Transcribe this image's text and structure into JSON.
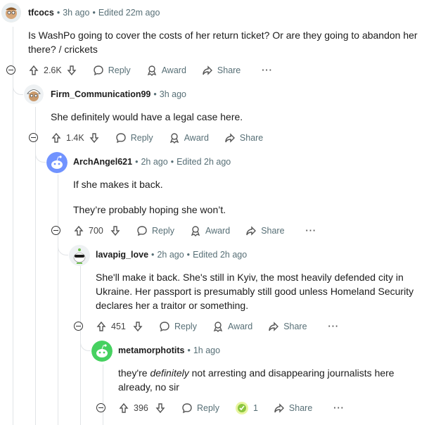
{
  "labels": {
    "reply": "Reply",
    "award": "Award",
    "share": "Share",
    "more": "···"
  },
  "comments": [
    {
      "user": "tfcocs",
      "age": "3h ago",
      "edited": "Edited 22m ago",
      "text": [
        "Is WashPo going to cover the costs of her return ticket? Or are they going to abandon her there? / crickets"
      ],
      "votes": "2.6K"
    },
    {
      "user": "Firm_Communication99",
      "age": "3h ago",
      "edited": "",
      "text": [
        "She definitely would have a legal case here."
      ],
      "votes": "1.4K"
    },
    {
      "user": "ArchAngel621",
      "age": "2h ago",
      "edited": "Edited 2h ago",
      "text": [
        "If she makes it back.",
        "They’re probably hoping she won’t."
      ],
      "votes": "700"
    },
    {
      "user": "lavapig_love",
      "age": "2h ago",
      "edited": "Edited 2h ago",
      "text": [
        "She'll make it back. She's still in Kyiv, the most heavily defended city in Ukraine. Her passport is presumably still good unless Homeland Security declares her a traitor or something."
      ],
      "votes": "451"
    },
    {
      "user": "metamorphotits",
      "age": "1h ago",
      "edited": "",
      "text_pre": "they're ",
      "text_em": "definitely",
      "text_post": " not arresting and disappearing journalists here already, no sir",
      "votes": "396",
      "award_count": "1"
    }
  ],
  "icons": [
    "collapse-icon",
    "upvote-icon",
    "downvote-icon",
    "reply-icon",
    "award-icon",
    "share-icon",
    "more-icon"
  ]
}
